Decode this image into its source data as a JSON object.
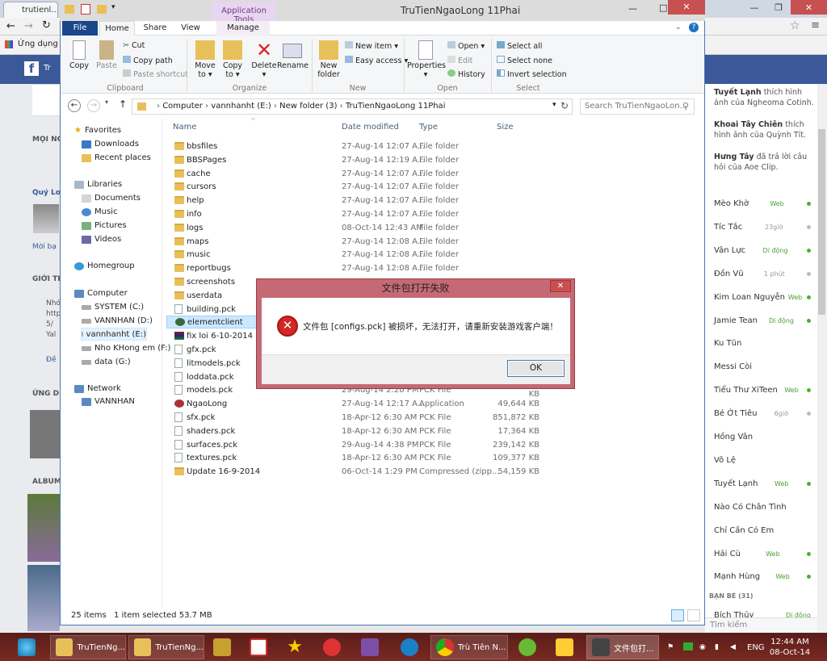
{
  "browser": {
    "tab_title": "trutienl...",
    "bookmarks_label": "Ứng dụng"
  },
  "facebook_left": {
    "labels": [
      "MỌI NG",
      "Quý Lo",
      "Mời bạ",
      "GIỚI TH",
      "Nhó",
      "http",
      "5/",
      "Yal",
      "Đề",
      "ỨNG D",
      "ALBUM"
    ],
    "header_text": "Tr"
  },
  "facebook_right": {
    "feed": [
      {
        "name": "Tuyết Lạnh",
        "text": " thích hình ảnh của Ngheoma Cotinh."
      },
      {
        "name": "Khoai Tây Chiên",
        "text": " thích hình ảnh của Quỳnh Tít."
      },
      {
        "name": "Hưng Tây",
        "text": " đã trả lời câu hỏi của Aoe Clip."
      }
    ],
    "friends": [
      {
        "name": "Mèo Khờ",
        "status": "Web",
        "online": true
      },
      {
        "name": "Tíc Tắc",
        "status": "23giờ",
        "online": false
      },
      {
        "name": "Vân Lực",
        "status": "Di động",
        "online": true
      },
      {
        "name": "Đồn Vũ",
        "status": "1 phút",
        "online": false
      },
      {
        "name": "Kim Loan Nguyễn",
        "status": "Web",
        "online": true
      },
      {
        "name": "Jamie Tean",
        "status": "Di động",
        "online": true
      },
      {
        "name": "Ku Tũn",
        "status": "",
        "online": false
      },
      {
        "name": "Messi Còi",
        "status": "",
        "online": false
      },
      {
        "name": "Tiểu Thư XiTeen",
        "status": "Web",
        "online": true
      },
      {
        "name": "Bé Ớt Tiêu",
        "status": "6giờ",
        "online": false
      },
      {
        "name": "Hồng Vân",
        "status": "",
        "online": false
      },
      {
        "name": "Vô Lệ",
        "status": "",
        "online": false
      },
      {
        "name": "Tuyết Lạnh",
        "status": "Web",
        "online": true
      },
      {
        "name": "Nào Có Chân Tình",
        "status": "",
        "online": false
      },
      {
        "name": "Chỉ Cần Có Em",
        "status": "",
        "online": false
      },
      {
        "name": "Hải Cù",
        "status": "Web",
        "online": true
      },
      {
        "name": "Mạnh Hùng",
        "status": "Web",
        "online": true
      }
    ],
    "more_friends_label": "BẠN BÈ (31)",
    "last_friend": {
      "name": "Bích Thủy",
      "status": "Di động"
    },
    "search_placeholder": "Tìm kiếm"
  },
  "explorer": {
    "title": "TruTienNgaoLong 11Phai",
    "contextual_tab": "Application Tools",
    "tabs": [
      "File",
      "Home",
      "Share",
      "View",
      "Manage"
    ],
    "ribbon": {
      "clipboard": {
        "copy": "Copy",
        "paste": "Paste",
        "cut": "Cut",
        "copy_path": "Copy path",
        "paste_shortcut": "Paste shortcut",
        "group": "Clipboard"
      },
      "organize": {
        "move_to": "Move to",
        "copy_to": "Copy to",
        "delete": "Delete",
        "rename": "Rename",
        "group": "Organize"
      },
      "new": {
        "new_folder": "New folder",
        "new_item": "New item",
        "easy_access": "Easy access",
        "group": "New"
      },
      "open": {
        "properties": "Properties",
        "open": "Open",
        "edit": "Edit",
        "history": "History",
        "group": "Open"
      },
      "select": {
        "select_all": "Select all",
        "select_none": "Select none",
        "invert": "Invert selection",
        "group": "Select"
      }
    },
    "address": [
      "Computer",
      "vannhanht (E:)",
      "New folder (3)",
      "TruTienNgaoLong 11Phai"
    ],
    "search_placeholder": "Search TruTienNgaoLon...",
    "nav": {
      "favorites": "Favorites",
      "downloads": "Downloads",
      "recent": "Recent places",
      "libraries": "Libraries",
      "documents": "Documents",
      "music": "Music",
      "pictures": "Pictures",
      "videos": "Videos",
      "homegroup": "Homegroup",
      "computer": "Computer",
      "drives": [
        "SYSTEM (C:)",
        "VANNHAN (D:)",
        "vannhanht (E:)",
        "Nho KHong em (F:)",
        "data (G:)"
      ],
      "network": "Network",
      "network_host": "VANNHAN"
    },
    "columns": [
      "Name",
      "Date modified",
      "Type",
      "Size"
    ],
    "files": [
      {
        "name": "bbsfiles",
        "date": "27-Aug-14 12:07 A...",
        "type": "File folder",
        "size": "",
        "kind": "folder"
      },
      {
        "name": "BBSPages",
        "date": "27-Aug-14 12:19 A...",
        "type": "File folder",
        "size": "",
        "kind": "folder"
      },
      {
        "name": "cache",
        "date": "27-Aug-14 12:07 A...",
        "type": "File folder",
        "size": "",
        "kind": "folder"
      },
      {
        "name": "cursors",
        "date": "27-Aug-14 12:07 A...",
        "type": "File folder",
        "size": "",
        "kind": "folder"
      },
      {
        "name": "help",
        "date": "27-Aug-14 12:07 A...",
        "type": "File folder",
        "size": "",
        "kind": "folder"
      },
      {
        "name": "info",
        "date": "27-Aug-14 12:07 A...",
        "type": "File folder",
        "size": "",
        "kind": "folder"
      },
      {
        "name": "logs",
        "date": "08-Oct-14 12:43 AM",
        "type": "File folder",
        "size": "",
        "kind": "folder"
      },
      {
        "name": "maps",
        "date": "27-Aug-14 12:08 A...",
        "type": "File folder",
        "size": "",
        "kind": "folder"
      },
      {
        "name": "music",
        "date": "27-Aug-14 12:08 A...",
        "type": "File folder",
        "size": "",
        "kind": "folder"
      },
      {
        "name": "reportbugs",
        "date": "27-Aug-14 12:08 A...",
        "type": "File folder",
        "size": "",
        "kind": "folder"
      },
      {
        "name": "screenshots",
        "date": "",
        "type": "",
        "size": "",
        "kind": "folder"
      },
      {
        "name": "userdata",
        "date": "",
        "type": "",
        "size": "",
        "kind": "folder"
      },
      {
        "name": "building.pck",
        "date": "",
        "type": "",
        "size": "",
        "kind": "file"
      },
      {
        "name": "elementclient",
        "date": "",
        "type": "",
        "size": "",
        "kind": "app",
        "selected": true
      },
      {
        "name": "fix loi 6-10-2014",
        "date": "",
        "type": "",
        "size": "",
        "kind": "rar"
      },
      {
        "name": "gfx.pck",
        "date": "",
        "type": "",
        "size": "",
        "kind": "file"
      },
      {
        "name": "litmodels.pck",
        "date": "",
        "type": "",
        "size": "",
        "kind": "file"
      },
      {
        "name": "loddata.pck",
        "date": "",
        "type": "",
        "size": "",
        "kind": "file"
      },
      {
        "name": "models.pck",
        "date": "29-Aug-14 2:20 PM",
        "type": "PCK File",
        "size": "1,193,657 KB",
        "kind": "file"
      },
      {
        "name": "NgaoLong",
        "date": "27-Aug-14 12:17 A...",
        "type": "Application",
        "size": "49,644 KB",
        "kind": "app2"
      },
      {
        "name": "sfx.pck",
        "date": "18-Apr-12 6:30 AM",
        "type": "PCK File",
        "size": "851,872 KB",
        "kind": "file"
      },
      {
        "name": "shaders.pck",
        "date": "18-Apr-12 6:30 AM",
        "type": "PCK File",
        "size": "17,364 KB",
        "kind": "file"
      },
      {
        "name": "surfaces.pck",
        "date": "29-Aug-14 4:38 PM",
        "type": "PCK File",
        "size": "239,142 KB",
        "kind": "file"
      },
      {
        "name": "textures.pck",
        "date": "18-Apr-12 6:30 AM",
        "type": "PCK File",
        "size": "109,377 KB",
        "kind": "file"
      },
      {
        "name": "Update 16-9-2014",
        "date": "06-Oct-14 1:29 PM",
        "type": "Compressed (zipp...",
        "size": "54,159 KB",
        "kind": "zip"
      }
    ],
    "status": {
      "count": "25 items",
      "selected": "1 item selected  53.7 MB"
    }
  },
  "dialog": {
    "title": "文件包打开失败",
    "message": "文件包 [configs.pck] 被损坏，无法打开，请重新安装游戏客户端！",
    "ok": "OK"
  },
  "taskbar": {
    "items": [
      "TruTienNg...",
      "TruTienNg...",
      "Trù Tiên N...",
      "文件包打..."
    ],
    "lang": "ENG",
    "time": "12:44 AM",
    "date": "08-Oct-14"
  },
  "colors": {
    "fb_blue": "#3b5998",
    "file_tab": "#19478a",
    "dialog_frame": "#c56a75",
    "taskbar": "#6a2420"
  }
}
